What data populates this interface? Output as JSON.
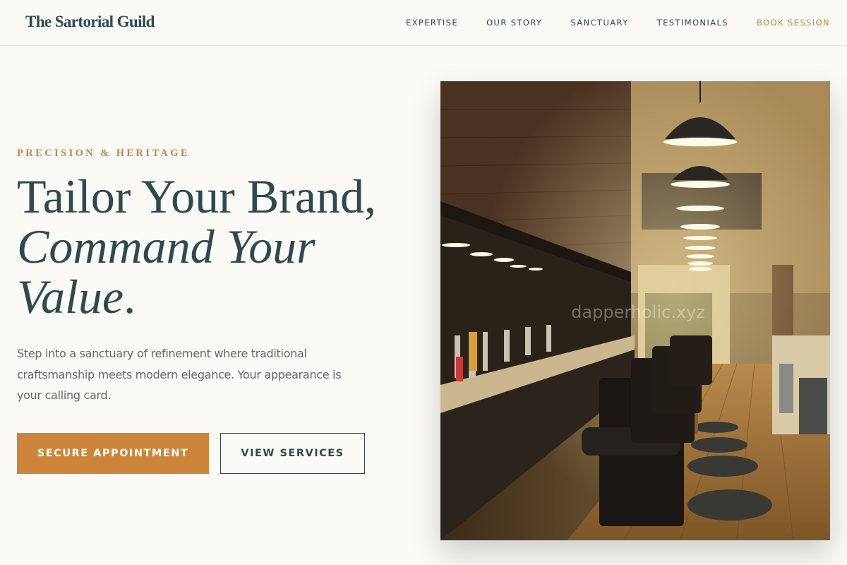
{
  "header": {
    "logo": "The Sartorial Guild",
    "nav": [
      {
        "label": "EXPERTISE"
      },
      {
        "label": "OUR STORY"
      },
      {
        "label": "SANCTUARY"
      },
      {
        "label": "TESTIMONIALS"
      },
      {
        "label": "BOOK SESSION"
      }
    ]
  },
  "hero": {
    "eyebrow": "PRECISION & HERITAGE",
    "headline_line1": "Tailor Your Brand,",
    "headline_line2": "Command Your",
    "headline_line3_italic": "Value",
    "headline_line3_end": ".",
    "description": "Step into a sanctuary of refinement where traditional craftsmanship meets modern elegance. Your appearance is your calling card.",
    "primary_button": "SECURE APPOINTMENT",
    "secondary_button": "VIEW SERVICES"
  },
  "photo": {
    "subject": "barbershop interior with barber chairs and pendant lamps",
    "watermark": "dapperholic.xyz"
  },
  "colors": {
    "accent": "#c8873f",
    "primary_text": "#2e4a4d",
    "background": "#fbfaf7"
  }
}
